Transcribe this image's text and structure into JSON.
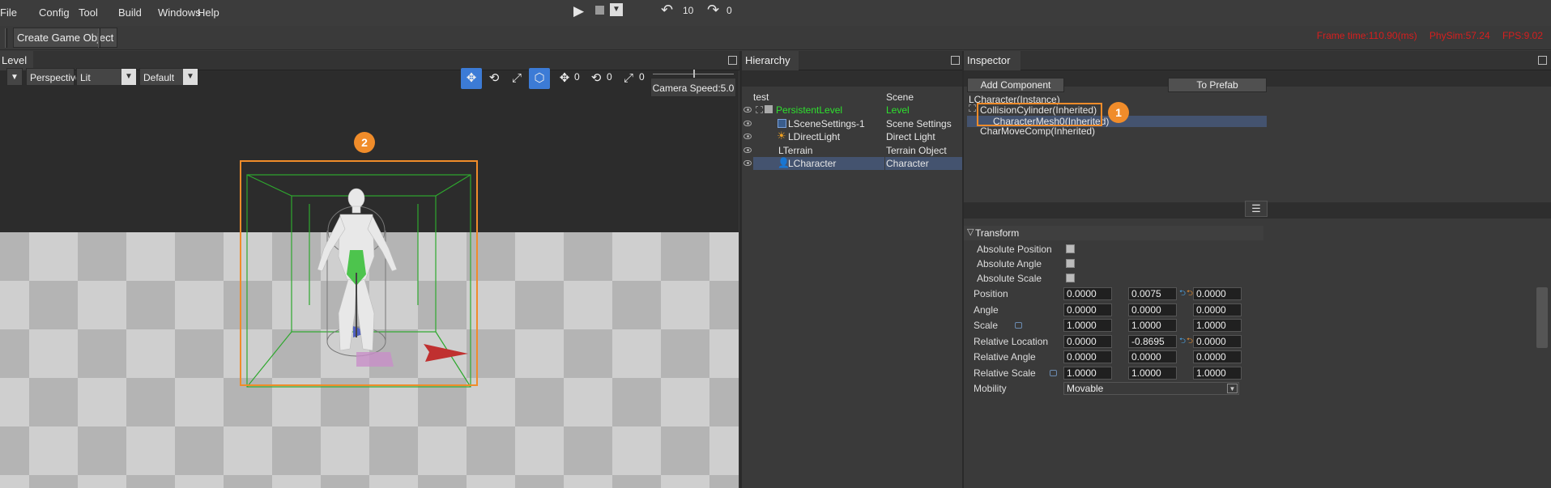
{
  "menu": [
    "File",
    "Config",
    "Tool",
    "Build",
    "Windows",
    "Help"
  ],
  "playbar": {
    "undo_count": "10",
    "redo_count": "0"
  },
  "toolbar": {
    "create_game_object": "Create Game Object"
  },
  "stats": {
    "frame_time": "Frame time:110.90(ms)",
    "physsim": "PhySim:57.24",
    "fps": "FPS:9.02"
  },
  "panels": {
    "level": "Level",
    "hierarchy": "Hierarchy",
    "inspector": "Inspector"
  },
  "viewport": {
    "view_mode": "Perspective",
    "lighting": "Lit",
    "profile": "Default",
    "move_snap": "0",
    "rotate_snap": "0",
    "scale_snap": "0",
    "camera_speed": "Camera Speed:5.0"
  },
  "hierarchy": {
    "header": {
      "name": "test",
      "type": "Scene"
    },
    "rows": [
      {
        "name": "PersistentLevel",
        "type": "Level",
        "color": "#2ee02e"
      },
      {
        "name": "LSceneSettings-1",
        "type": "Scene Settings",
        "color": "#e6e6e6"
      },
      {
        "name": "LDirectLight",
        "type": "Direct Light",
        "color": "#e6e6e6"
      },
      {
        "name": "LTerrain",
        "type": "Terrain Object",
        "color": "#e6e6e6"
      },
      {
        "name": "LCharacter",
        "type": "Character",
        "color": "#e6e6e6"
      }
    ]
  },
  "inspector": {
    "add_component": "Add Component",
    "to_prefab": "To Prefab",
    "instance_name": "LCharacter(Instance)",
    "components": [
      "CollisionCylinder(Inherited)",
      "CharacterMesh0(Inherited)",
      "CharMoveComp(Inherited)"
    ],
    "transform": {
      "title": "Transform",
      "absolute_position": "Absolute Position",
      "absolute_angle": "Absolute Angle",
      "absolute_scale": "Absolute Scale",
      "position": {
        "label": "Position",
        "values": [
          "0.0000",
          "0.0075",
          "0.0000"
        ]
      },
      "angle": {
        "label": "Angle",
        "values": [
          "0.0000",
          "0.0000",
          "0.0000"
        ]
      },
      "scale": {
        "label": "Scale",
        "values": [
          "1.0000",
          "1.0000",
          "1.0000"
        ]
      },
      "relative_location": {
        "label": "Relative Location",
        "values": [
          "0.0000",
          "-0.8695",
          "0.0000"
        ]
      },
      "relative_angle": {
        "label": "Relative Angle",
        "values": [
          "0.0000",
          "0.0000",
          "0.0000"
        ]
      },
      "relative_scale": {
        "label": "Relative Scale",
        "values": [
          "1.0000",
          "1.0000",
          "1.0000"
        ]
      },
      "mobility": {
        "label": "Mobility",
        "value": "Movable"
      }
    }
  },
  "badges": {
    "one": "1",
    "two": "2"
  },
  "colors": {
    "accent_orange": "#f08c2a",
    "selection_blue": "#44536f",
    "level_green": "#2ee02e",
    "stats_red": "#d81e1e"
  }
}
